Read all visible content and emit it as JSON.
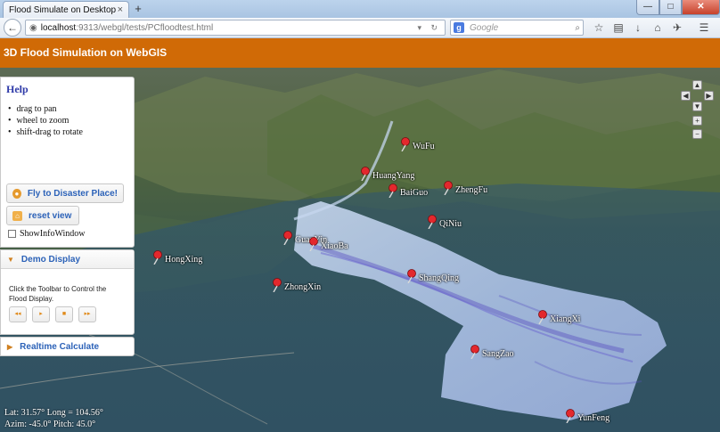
{
  "browser": {
    "tab_title": "Flood Simulate on Desktop",
    "tab_close": "×",
    "new_tab": "+",
    "url_host": "localhost",
    "url_rest": ":9313/webgl/tests/PCfloodtest.html",
    "search_engine": "g",
    "search_placeholder": "Google",
    "back_glyph": "←",
    "window": {
      "minimize": "—",
      "maximize": "□",
      "close": "✕"
    },
    "toolbar_icons": [
      "☆",
      "▤",
      "↓",
      "⌂",
      "✈",
      "☰"
    ]
  },
  "app": {
    "title": "3D Flood Simulation on WebGIS"
  },
  "help": {
    "title": "Help",
    "items": [
      "drag to pan",
      "wheel to zoom",
      "shift-drag to rotate"
    ],
    "fly_button": "Fly to Disaster Place!",
    "reset_button": "reset view",
    "info_window_label": "ShowInfoWindow"
  },
  "demo": {
    "title": "Demo Display",
    "description": "Click the Toolbar to Control the Flood Display.",
    "controls": [
      "◂◂",
      "▸",
      "■",
      "▸▸"
    ]
  },
  "realtime": {
    "title": "Realtime Calculate"
  },
  "map": {
    "places": [
      {
        "name": "WuFu"
      },
      {
        "name": "HuangYang"
      },
      {
        "name": "BaiGuo"
      },
      {
        "name": "ZhengFu"
      },
      {
        "name": "QiNiu"
      },
      {
        "name": "GuanYin"
      },
      {
        "name": "XiaoBa"
      },
      {
        "name": "HongXing"
      },
      {
        "name": "ShangQing"
      },
      {
        "name": "ZhongXin"
      },
      {
        "name": "XiangXi"
      },
      {
        "name": "SangZao"
      },
      {
        "name": "YunFeng"
      }
    ],
    "coords_line1": "Lat: 31.57° Long = 104.56°",
    "coords_line2": "Azim: -45.0° Pitch: 45.0°",
    "nav_glyphs": [
      "▲",
      "◀",
      "▶",
      "▼",
      "+",
      "−"
    ]
  },
  "colors": {
    "header": "#d06a06",
    "help_title": "#2e3aa8",
    "accordion_text": "#2c62b8",
    "flood_water": "#b6cbea",
    "flood_dark": "#5a52c2"
  }
}
